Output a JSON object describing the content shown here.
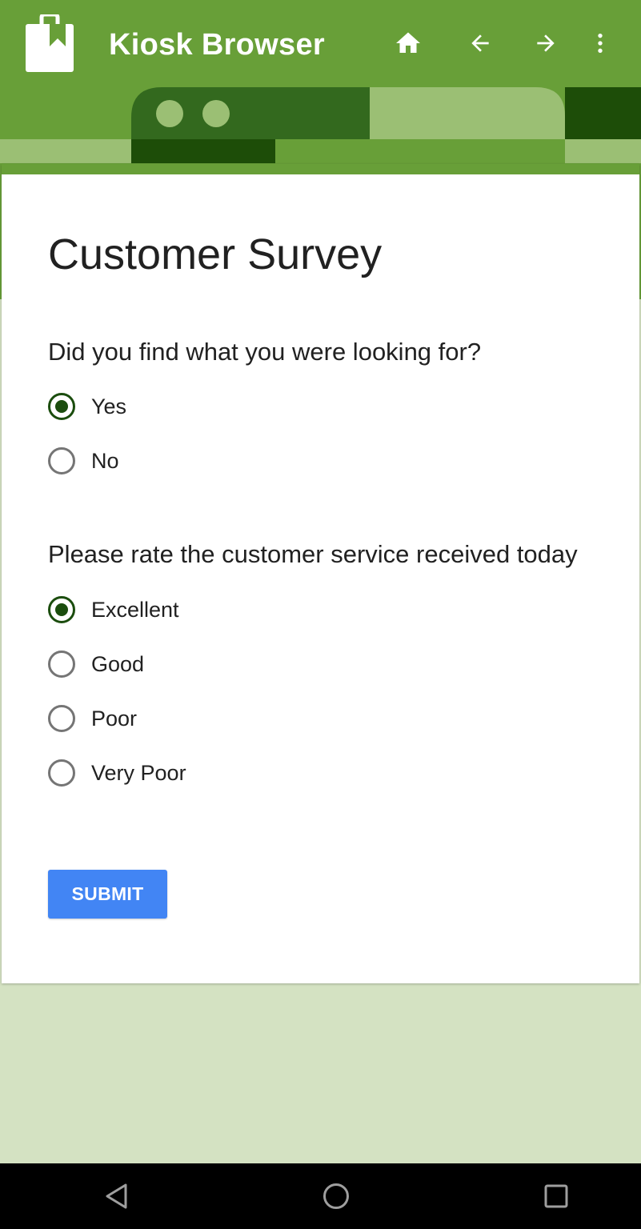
{
  "app_bar": {
    "title": "Kiosk Browser",
    "logo_icon": "shopping-bag-icon",
    "actions": [
      {
        "icon": "home-icon"
      },
      {
        "icon": "arrow-back-icon"
      },
      {
        "icon": "arrow-forward-icon"
      },
      {
        "icon": "more-vert-icon"
      }
    ],
    "color": "#689f38"
  },
  "survey": {
    "title": "Customer Survey",
    "questions": [
      {
        "text": "Did you find what you were looking for?",
        "options": [
          {
            "label": "Yes",
            "selected": true
          },
          {
            "label": "No",
            "selected": false
          }
        ]
      },
      {
        "text": "Please rate the customer service received today",
        "options": [
          {
            "label": "Excellent",
            "selected": true
          },
          {
            "label": "Good",
            "selected": false
          },
          {
            "label": "Poor",
            "selected": false
          },
          {
            "label": "Very Poor",
            "selected": false
          }
        ]
      }
    ],
    "submit_label": "SUBMIT"
  },
  "nav_bar": {
    "buttons": [
      {
        "icon": "triangle-back-icon"
      },
      {
        "icon": "circle-home-icon"
      },
      {
        "icon": "square-recents-icon"
      }
    ]
  },
  "colors": {
    "accent": "#689f38",
    "radio_selected": "#1b4d0e",
    "submit": "#4285f4",
    "page_background": "#d4e2c2"
  }
}
